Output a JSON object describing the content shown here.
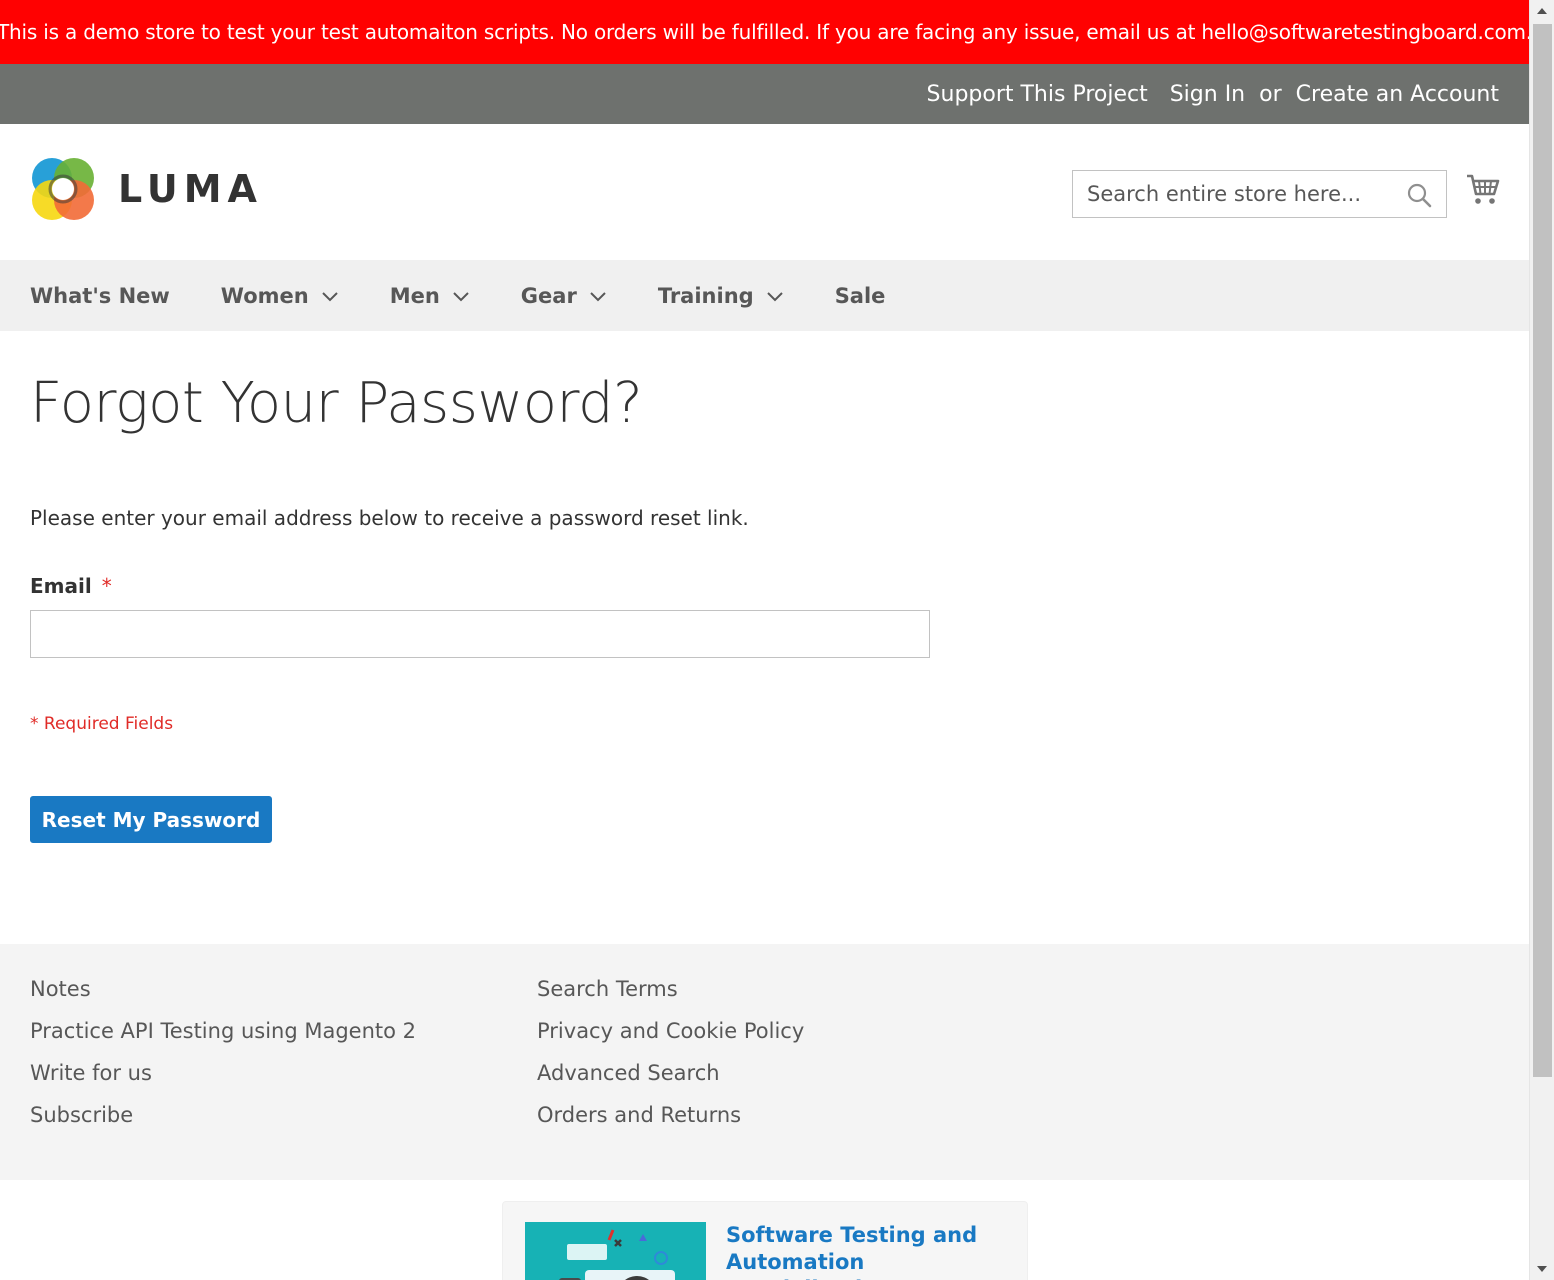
{
  "banner": {
    "text": "This is a demo store to test your test automaiton scripts. No orders will be fulfilled. If you are facing any issue, email us at hello@softwaretestingboard.com."
  },
  "header": {
    "support_link": "Support This Project",
    "sign_in": "Sign In",
    "or": "or",
    "create_account": "Create an Account",
    "logo_text": "LUMA",
    "search_placeholder": "Search entire store here..."
  },
  "nav": {
    "items": [
      {
        "label": "What's New",
        "dropdown": false
      },
      {
        "label": "Women",
        "dropdown": true
      },
      {
        "label": "Men",
        "dropdown": true
      },
      {
        "label": "Gear",
        "dropdown": true
      },
      {
        "label": "Training",
        "dropdown": true
      },
      {
        "label": "Sale",
        "dropdown": false
      }
    ]
  },
  "main": {
    "title": "Forgot Your Password?",
    "intro": "Please enter your email address below to receive a password reset link.",
    "email_label": "Email",
    "required_marker": "*",
    "email_value": "",
    "required_note": "* Required Fields",
    "submit_label": "Reset My Password"
  },
  "footer": {
    "col1": [
      "Notes",
      "Practice API Testing using Magento 2",
      "Write for us",
      "Subscribe"
    ],
    "col2": [
      "Search Terms",
      "Privacy and Cookie Policy",
      "Advanced Search",
      "Orders and Returns"
    ]
  },
  "promo": {
    "title": "Software Testing and Automation Specialization"
  },
  "colors": {
    "banner_bg": "#ff0101",
    "header_bg": "#6e716e",
    "nav_bg": "#f0f0f0",
    "primary_button": "#1979c3",
    "required": "#e02b27",
    "footer_bg": "#f4f4f4"
  }
}
